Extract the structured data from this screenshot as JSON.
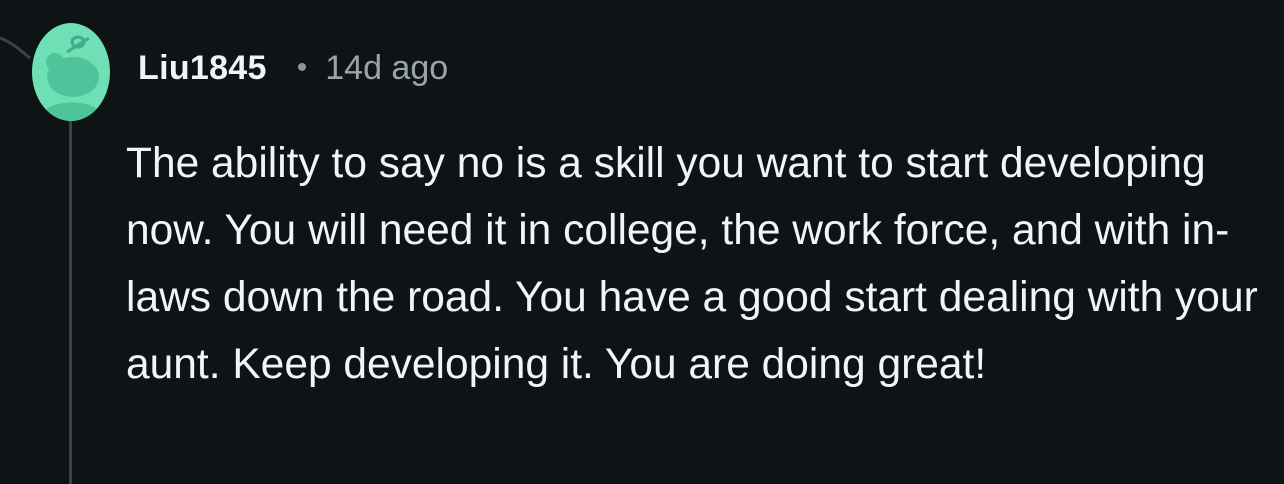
{
  "comment": {
    "author": "Liu1845",
    "separator": "•",
    "timestamp": "14d ago",
    "body": "The ability to say no is a skill you want to start developing now. You will need it in college, the work force, and with in-laws down the road. You have a good start dealing with your aunt. Keep developing it. You are doing great!"
  },
  "colors": {
    "background": "#0e1415",
    "text": "#f2f4f5",
    "muted": "#9aa4a6",
    "avatar": "#6fe0b6",
    "thread_line": "#3a4244"
  },
  "icons": {
    "avatar": "snoo-avatar-icon"
  }
}
